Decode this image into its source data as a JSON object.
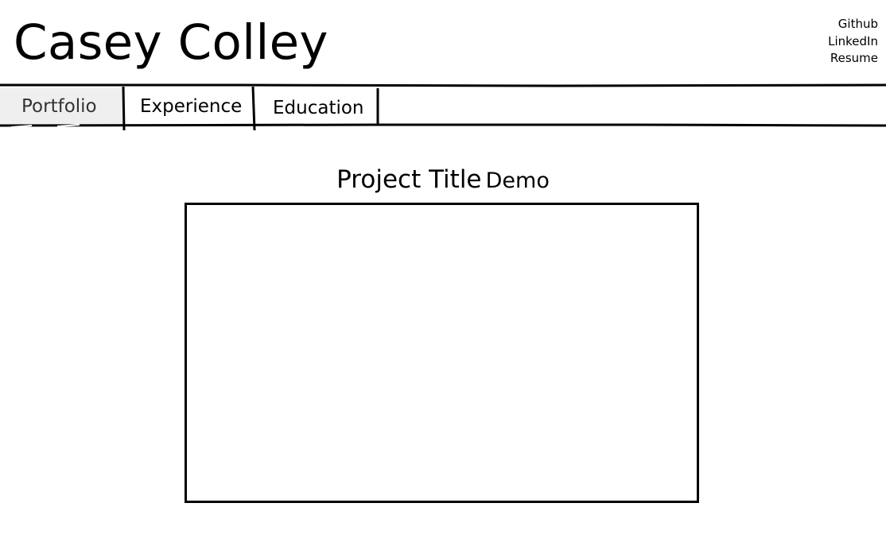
{
  "header": {
    "site_name": "Casey Colley",
    "links": {
      "github": "Github",
      "linkedin": "LinkedIn",
      "resume": "Resume"
    }
  },
  "nav": {
    "tabs": {
      "portfolio": "Portfolio",
      "experience": "Experience",
      "education": "Education"
    },
    "active_tab": "Portfolio"
  },
  "main": {
    "project_title": "Project Title",
    "demo_label": "Demo"
  },
  "colors": {
    "active_tab_bg": "#efefef",
    "ink": "#000000"
  }
}
